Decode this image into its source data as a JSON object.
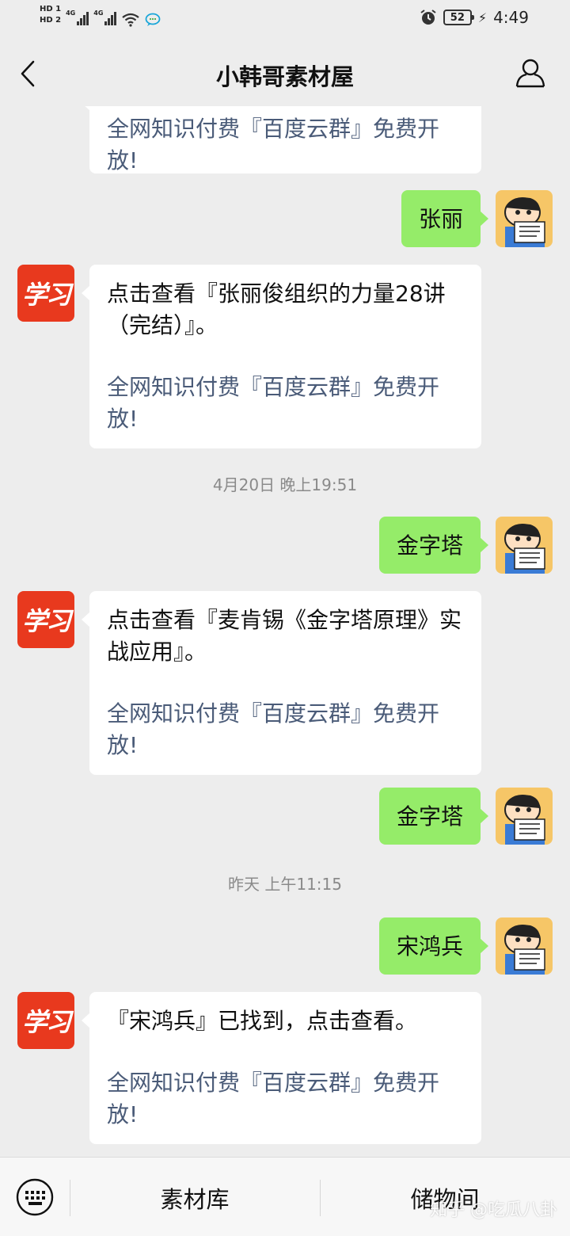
{
  "status_bar": {
    "sim1": "HD 1",
    "sim2": "HD 2",
    "network1": "4G",
    "network2": "4G",
    "battery_level": "52",
    "time": "4:49"
  },
  "header": {
    "title": "小韩哥素材屋"
  },
  "messages": {
    "m0": {
      "line2": "全网知识付费『百度云群』免费开放!"
    },
    "m1": {
      "text": "张丽"
    },
    "m2": {
      "line1": "点击查看『张丽俊组织的力量28讲（完结）』。",
      "line2": "全网知识付费『百度云群』免费开放!"
    },
    "ts1": "4月20日 晚上19:51",
    "m3": {
      "text": "金字塔"
    },
    "m4": {
      "line1": "点击查看『麦肯锡《金字塔原理》实战应用』。",
      "line2": "全网知识付费『百度云群』免费开放!"
    },
    "m5": {
      "text": "金字塔"
    },
    "ts2": "昨天 上午11:15",
    "m6": {
      "text": "宋鸿兵"
    },
    "m7": {
      "line1": "『宋鸿兵』已找到，点击查看。",
      "line2": "全网知识付费『百度云群』免费开放!"
    }
  },
  "avatars": {
    "bot_logo_text": "学习"
  },
  "bottom_menu": {
    "item1": "素材库",
    "item2": "储物间"
  },
  "watermark": "知乎 @吃瓜八卦",
  "colors": {
    "background": "#ededed",
    "outgoing_bubble": "#95ec69",
    "incoming_bubble": "#ffffff",
    "link_text": "#4a5b78",
    "bot_avatar": "#e8391e"
  }
}
